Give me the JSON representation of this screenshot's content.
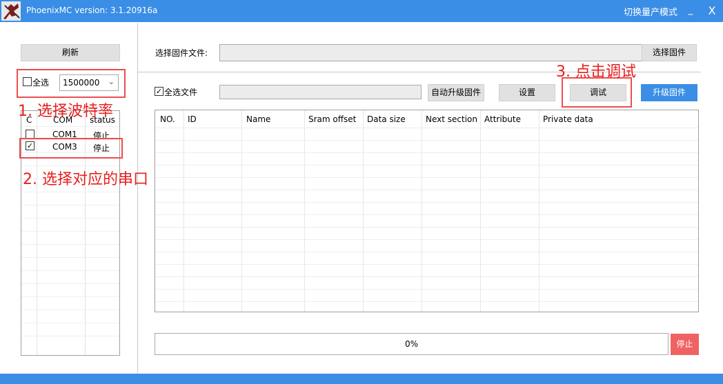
{
  "window": {
    "title": "PhoenixMC version: 3.1.20916a",
    "mode_switch": "切换量产模式",
    "minimize": "_",
    "close": "X"
  },
  "left_panel": {
    "refresh_label": "刷新",
    "select_all_label": "全选",
    "select_all_checked": false,
    "baud_rate": "1500000",
    "columns": [
      "C",
      "COM",
      "status"
    ],
    "ports": [
      {
        "checked": false,
        "com": "COM1",
        "status": "停止"
      },
      {
        "checked": true,
        "com": "COM3",
        "status": "停止"
      }
    ]
  },
  "firmware": {
    "label": "选择固件文件:",
    "path": "",
    "select_button": "选择固件"
  },
  "toolbar": {
    "select_all_files_label": "全选文件",
    "select_all_files_checked": true,
    "file_path": "",
    "auto_upgrade_label": "自动升级固件",
    "settings_label": "设置",
    "debug_label": "调试",
    "upgrade_label": "升级固件"
  },
  "table": {
    "headers": [
      "NO.",
      "ID",
      "Name",
      "Sram offset",
      "Data size",
      "Next section",
      "Attribute",
      "Private data"
    ]
  },
  "progress": {
    "text": "0%",
    "value": 0,
    "stop_label": "停止"
  },
  "annotations": {
    "step1": "1. 选择波特率",
    "step2": "2. 选择对应的串口",
    "step3": "3. 点击调试"
  },
  "colors": {
    "accent": "#3a8ee6",
    "annotation_red": "#e81e1e",
    "stop_red": "#f06262"
  }
}
